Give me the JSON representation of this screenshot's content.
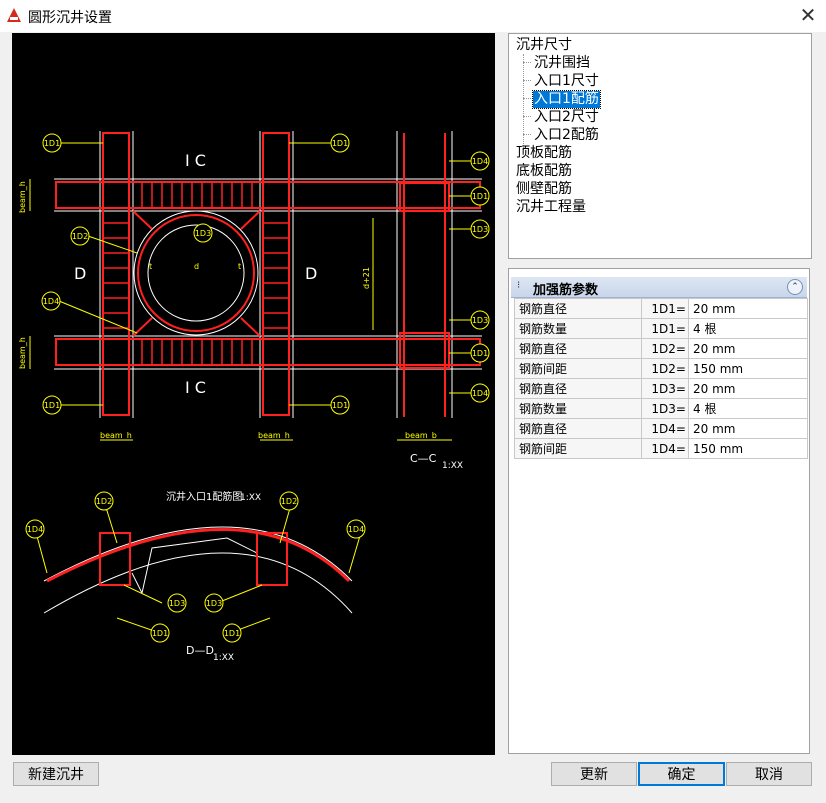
{
  "window": {
    "title": "圆形沉井设置",
    "close_glyph": "✕"
  },
  "drawing": {
    "label_ic": "I C",
    "label_d": "D",
    "label_d_small": "d",
    "label_t": "t",
    "label_beam_h": "beam_h",
    "label_beam_b": "beam_b",
    "label_d21": "d+21",
    "title_plan": "沉井入口1配筋图",
    "scale": "1:XX",
    "title_cc": "C—C",
    "title_dd": "D—D",
    "tags": {
      "d1": "1D1",
      "d2": "1D2",
      "d3": "1D3",
      "d4": "1D4"
    }
  },
  "tree": {
    "items": [
      {
        "label": "沉井尺寸",
        "level": 0
      },
      {
        "label": "沉井围挡",
        "level": 1
      },
      {
        "label": "入口1尺寸",
        "level": 1
      },
      {
        "label": "入口1配筋",
        "level": 1,
        "selected": true
      },
      {
        "label": "入口2尺寸",
        "level": 1
      },
      {
        "label": "入口2配筋",
        "level": 1
      },
      {
        "label": "顶板配筋",
        "level": 0
      },
      {
        "label": "底板配筋",
        "level": 0
      },
      {
        "label": "侧壁配筋",
        "level": 0
      },
      {
        "label": "沉井工程量",
        "level": 0
      }
    ]
  },
  "properties": {
    "title": "加强筋参数",
    "rows": [
      {
        "name": "钢筋直径",
        "key": "1D1=",
        "value": "20 mm"
      },
      {
        "name": "钢筋数量",
        "key": "1D1=",
        "value": "4 根"
      },
      {
        "name": "钢筋直径",
        "key": "1D2=",
        "value": "20 mm"
      },
      {
        "name": "钢筋间距",
        "key": "1D2=",
        "value": "150 mm"
      },
      {
        "name": "钢筋直径",
        "key": "1D3=",
        "value": "20 mm"
      },
      {
        "name": "钢筋数量",
        "key": "1D3=",
        "value": "4 根"
      },
      {
        "name": "钢筋直径",
        "key": "1D4=",
        "value": "20 mm"
      },
      {
        "name": "钢筋间距",
        "key": "1D4=",
        "value": "150 mm"
      }
    ]
  },
  "buttons": {
    "new": "新建沉井",
    "update": "更新",
    "ok": "确定",
    "cancel": "取消"
  }
}
